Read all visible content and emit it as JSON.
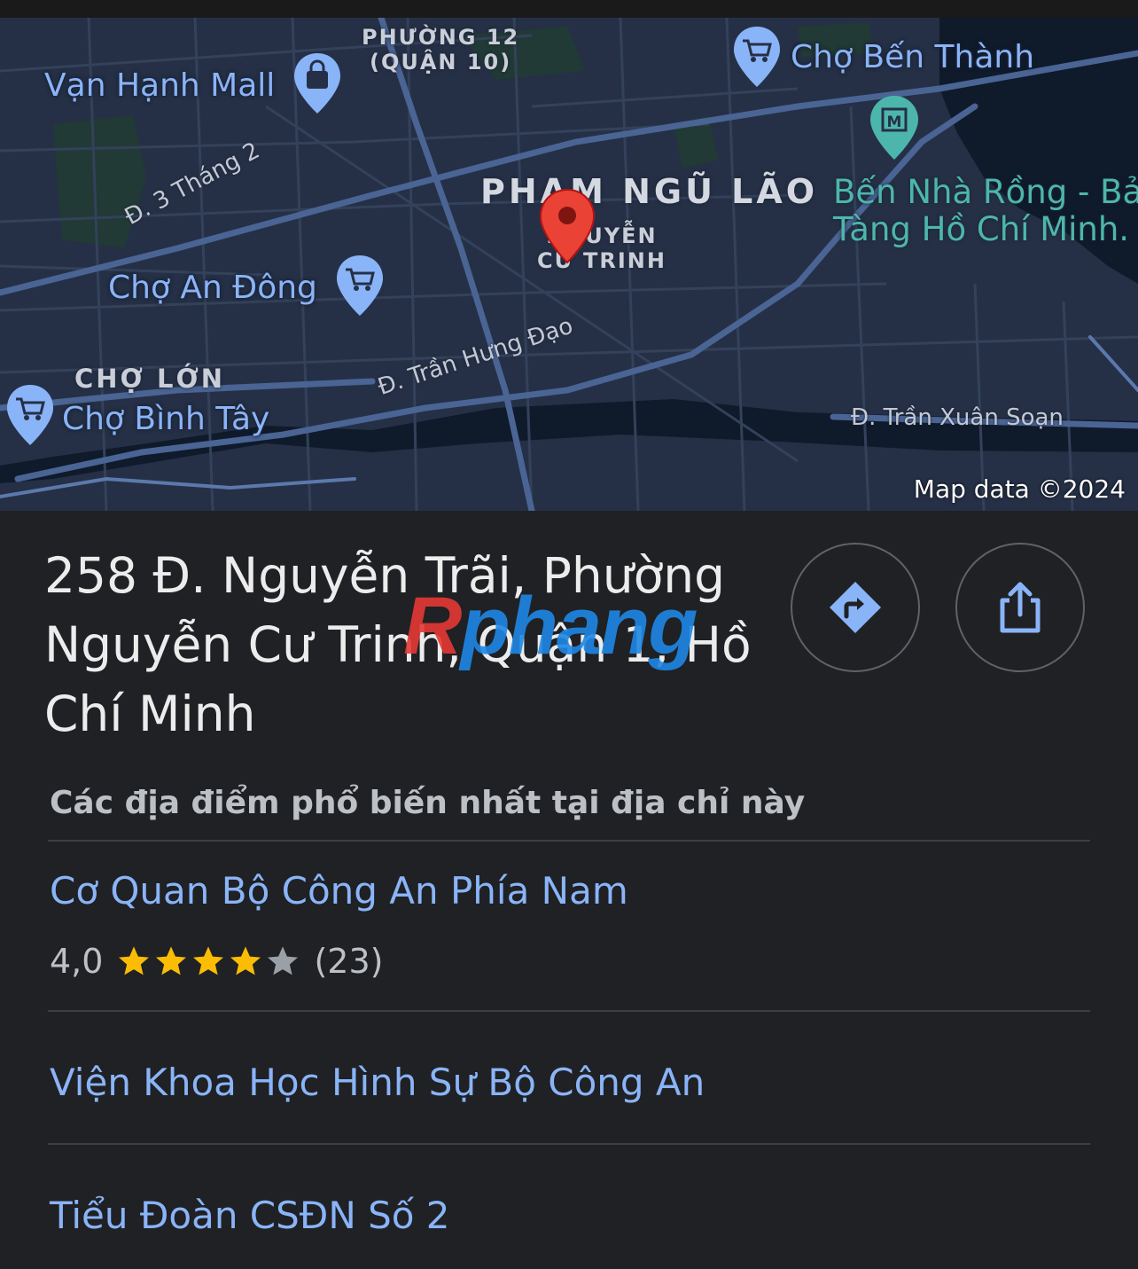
{
  "map": {
    "labels": {
      "phuong12": "PHƯỜNG 12\n(QUẬN 10)",
      "van_hanh_mall": "Vạn Hạnh Mall",
      "cho_ben_thanh": "Chợ Bến Thành",
      "pham_ngu_lao": "PHẠM NGŨ LÃO",
      "ben_nha_rong": "Bến Nhà Rồng - Bả\nTàng Hồ Chí Minh.",
      "nguyen_cu_trinh": "NGUYỄN\nCƯ TRINH",
      "d_3_thang_2": "Đ. 3 Tháng 2",
      "cho_an_dong": "Chợ An Đông",
      "cho_lon": "CHỢ LỚN",
      "cho_binh_tay": "Chợ Bình Tây",
      "d_tran_hung_dao": "Đ. Trần Hưng Đạo",
      "d_tran_xuan_soan": "Đ. Trần Xuân Soạn"
    },
    "credit": "Map data ©2024",
    "icons": [
      "shopping-bag-icon",
      "shopping-cart-icon",
      "museum-icon",
      "location-pin-icon"
    ]
  },
  "address": "258 Đ. Nguyễn Trãi, Phường Nguyễn Cư Trinh, Quận 1, Hồ Chí Minh",
  "actions": {
    "directions_icon": "directions-icon",
    "share_icon": "share-icon"
  },
  "watermark": {
    "r": "R",
    "rest": "phang"
  },
  "popular_places": {
    "title": "Các địa điểm phổ biến nhất tại địa chỉ này",
    "items": [
      {
        "name": "Cơ Quan Bộ Công An Phía Nam",
        "rating": "4,0",
        "rating_value": 4.0,
        "reviews": "(23)"
      },
      {
        "name": "Viện Khoa Học Hình Sự Bộ Công An"
      },
      {
        "name": "Tiểu Đoàn CSĐN Số 2"
      }
    ]
  },
  "colors": {
    "background": "#202124",
    "map_base": "#253046",
    "link": "#8ab4f8",
    "star_filled": "#fbbc04",
    "star_empty": "#9aa0a6",
    "pin": "#ea4335"
  }
}
